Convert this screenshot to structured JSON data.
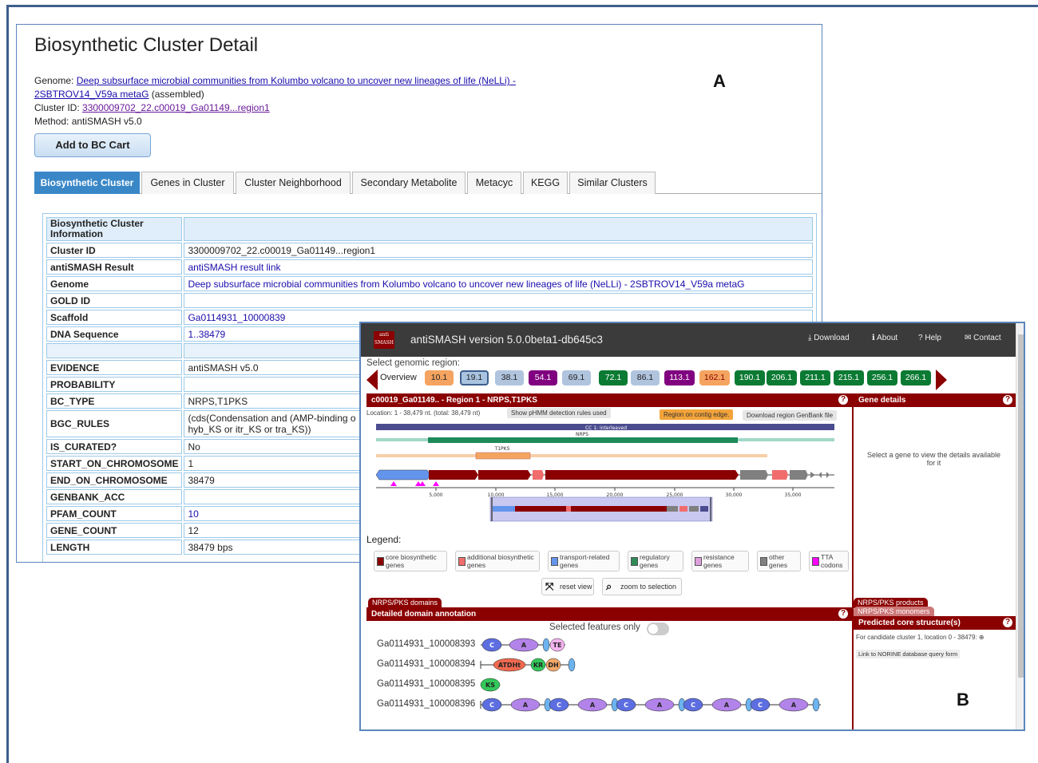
{
  "panel_a": {
    "label": "A",
    "title": "Biosynthetic Cluster Detail",
    "genome_label": "Genome: ",
    "genome_link_line1": "Deep subsurface microbial communities from Kolumbo volcano to uncover new lineages of life (NeLLi) -",
    "genome_link_line2": "2SBTROV14_V59a metaG",
    "genome_suffix": " (assembled)",
    "cluster_id_label": "Cluster ID: ",
    "cluster_id_link": "3300009702_22.c00019_Ga01149...region1",
    "method": "Method: antiSMASH v5.0",
    "add_button": "Add to BC Cart",
    "tabs": [
      "Biosynthetic Cluster",
      "Genes in Cluster",
      "Cluster Neighborhood",
      "Secondary Metabolite",
      "Metacyc",
      "KEGG",
      "Similar Clusters"
    ],
    "info_header": "Biosynthetic Cluster Information",
    "rows": [
      {
        "k": "Cluster ID",
        "v": "3300009702_22.c00019_Ga01149...region1",
        "link": false
      },
      {
        "k": "antiSMASH Result",
        "v": "antiSMASH result link",
        "link": true
      },
      {
        "k": "Genome",
        "v": "Deep subsurface microbial communities from Kolumbo volcano to uncover new lineages of life (NeLLi) - 2SBTROV14_V59a metaG",
        "link": true
      },
      {
        "k": "GOLD ID",
        "v": "",
        "link": false
      },
      {
        "k": "Scaffold",
        "v": "Ga0114931_10000839",
        "link": true
      },
      {
        "k": "DNA Sequence",
        "v": "1..38479",
        "link": true
      },
      {
        "k": "",
        "v": "",
        "link": false,
        "blank": true
      },
      {
        "k": "EVIDENCE",
        "v": "antiSMASH v5.0",
        "link": false
      },
      {
        "k": "PROBABILITY",
        "v": "",
        "link": false
      },
      {
        "k": "BC_TYPE",
        "v": "NRPS,T1PKS",
        "link": false
      },
      {
        "k": "BGC_RULES",
        "v": "(cds(Condensation and (AMP-binding o",
        "v2": "hyb_KS or itr_KS or tra_KS))",
        "link": false,
        "tall": true
      },
      {
        "k": "IS_CURATED?",
        "v": "No",
        "link": false
      },
      {
        "k": "START_ON_CHROMOSOME",
        "v": "1",
        "link": false
      },
      {
        "k": "END_ON_CHROMOSOME",
        "v": "38479",
        "link": false
      },
      {
        "k": "GENBANK_ACC",
        "v": "",
        "link": false
      },
      {
        "k": "PFAM_COUNT",
        "v": "10",
        "link": true
      },
      {
        "k": "GENE_COUNT",
        "v": "12",
        "link": false
      },
      {
        "k": "LENGTH",
        "v": "38479 bps",
        "link": false
      }
    ]
  },
  "panel_b": {
    "label": "B",
    "app_title": "antiSMASH version 5.0.0beta1-db645c3",
    "logo_text": "anti SMASH",
    "nav": {
      "download": "Download",
      "about": "About",
      "help": "Help",
      "contact": "Contact"
    },
    "select_region": "Select genomic region:",
    "overview": "Overview",
    "regions": [
      {
        "label": "10.1",
        "bg": "#f4a460",
        "fg": "#222"
      },
      {
        "label": "19.1",
        "bg": "#a8c4e0",
        "fg": "#222",
        "selected": true
      },
      {
        "label": "38.1",
        "bg": "#b0c4de",
        "fg": "#222"
      },
      {
        "label": "54.1",
        "bg": "#800080",
        "fg": "#fff"
      },
      {
        "label": "69.1",
        "bg": "#b0c4de",
        "fg": "#222"
      },
      {
        "label": "72.1",
        "bg": "#0b7a33",
        "fg": "#fff"
      },
      {
        "label": "86.1",
        "bg": "#b0c4de",
        "fg": "#222"
      },
      {
        "label": "113.1",
        "bg": "#800080",
        "fg": "#fff"
      },
      {
        "label": "162.1",
        "bg": "#f4a460",
        "fg": "#8b0000"
      },
      {
        "label": "190.1",
        "bg": "#0b7a33",
        "fg": "#fff"
      },
      {
        "label": "206.1",
        "bg": "#0b7a33",
        "fg": "#fff"
      },
      {
        "label": "211.1",
        "bg": "#0b7a33",
        "fg": "#fff"
      },
      {
        "label": "215.1",
        "bg": "#0b7a33",
        "fg": "#fff"
      },
      {
        "label": "256.1",
        "bg": "#0b7a33",
        "fg": "#fff"
      },
      {
        "label": "266.1",
        "bg": "#0b7a33",
        "fg": "#fff"
      }
    ],
    "region_header": "c00019_Ga01149.. - Region 1 - NRPS,T1PKS",
    "gene_details_header": "Gene details",
    "location": "Location: 1 - 38,479 nt. (total: 38,479 nt)",
    "show_rules_btn": "Show pHMM detection rules used",
    "contig_edge_btn": "Region on contig edge.",
    "download_region_btn": "Download region GenBank file",
    "cc_label": "CC 1: interleaved",
    "nrps_label": "NRPS",
    "t1pks_label": "T1PKS",
    "axis_ticks": [
      "5,000",
      "10,000",
      "15,000",
      "20,000",
      "25,000",
      "30,000",
      "35,000"
    ],
    "gene_detail_msg": "Select a gene to view the details available for it",
    "legend_title": "Legend:",
    "legend": [
      {
        "label": "core biosynthetic genes",
        "color": "#8b0000"
      },
      {
        "label": "additional biosynthetic genes",
        "color": "#f16d6d"
      },
      {
        "label": "transport-related genes",
        "color": "#6495ed"
      },
      {
        "label": "regulatory genes",
        "color": "#2e8b57"
      },
      {
        "label": "resistance genes",
        "color": "#dda0dd"
      },
      {
        "label": "other genes",
        "color": "#808080"
      },
      {
        "label": "TTA codons",
        "color": "#ff00ff"
      }
    ],
    "reset_view": "reset view",
    "zoom_selection": "zoom to selection",
    "tab_domains": "NRPS/PKS domains",
    "detailed_header": "Detailed domain annotation",
    "tab_products": "NRPS/PKS products",
    "tab_monomers": "NRPS/PKS monomers",
    "predicted_header": "Predicted core structure(s)",
    "selected_only": "Selected features only",
    "core_text": "For candidate cluster 1, location 0 - 38479:",
    "norine_link": "Link to NORINE database query form",
    "domain_genes": [
      "Ga0114931_100008393",
      "Ga0114931_100008394",
      "Ga0114931_100008395",
      "Ga0114931_100008396"
    ],
    "domains": {
      "C": "C",
      "A": "A",
      "TE": "TE",
      "ATDHt": "ATDHt",
      "KR": "KR",
      "DH": "DH",
      "KS": "KS"
    }
  }
}
